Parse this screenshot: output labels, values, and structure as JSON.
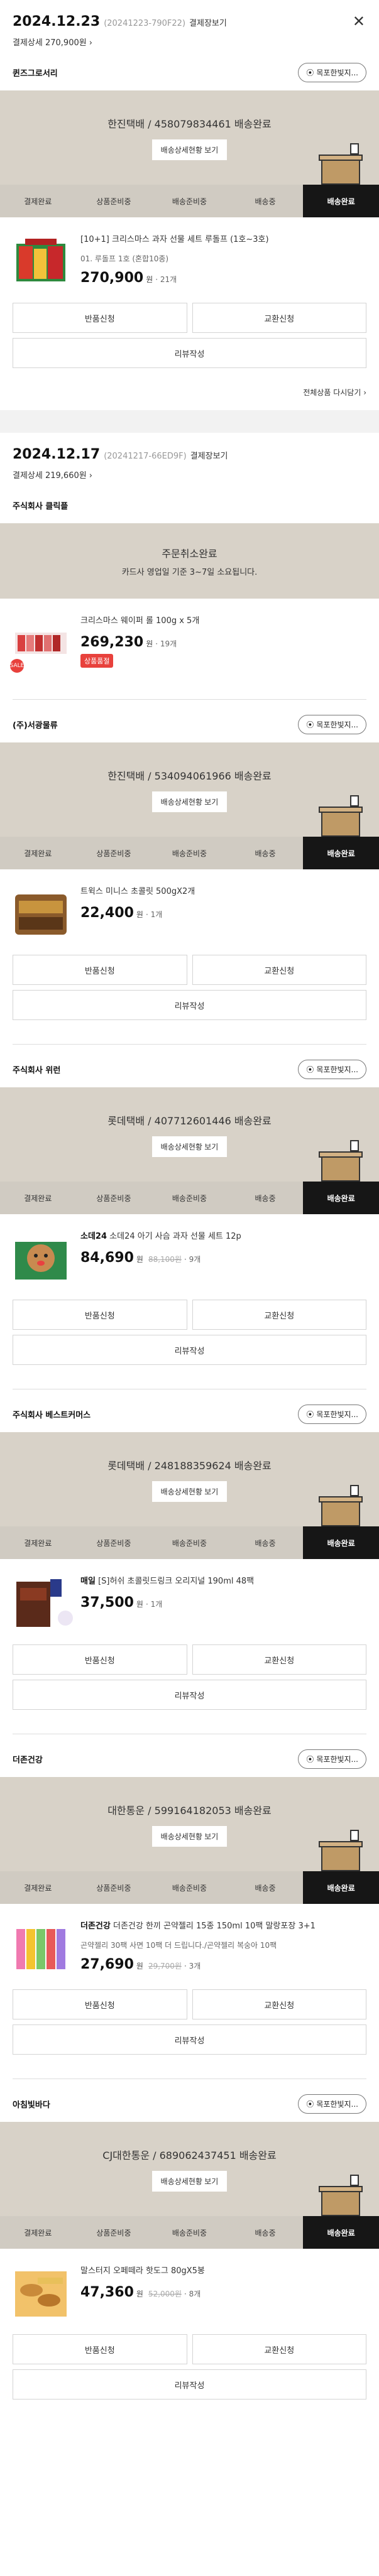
{
  "orders": [
    {
      "date": "2024.12.23",
      "order_no": "(20241223-790F22)",
      "receipt": "결제장보기",
      "detail": "결제상세 270,900원",
      "sellers": [
        {
          "name": "퀸즈그로서리",
          "pill": "목포한빛지...",
          "status_title": "한진택배 / 458079834461 배송완료",
          "status_btn": "배송상세현황 보기",
          "steps": [
            "결제완료",
            "상품준비중",
            "배송준비중",
            "배송중",
            "배송완료"
          ],
          "product": {
            "name": "[10+1] 크리스마스 과자 선물 세트 루돌프 (1호~3호)",
            "option": "01. 루돌프 1호 (혼합10종)",
            "price": "270,900",
            "won": "원",
            "qty": "· 21개"
          },
          "buttons": [
            "반품신청",
            "교환신청",
            "리뷰작성"
          ]
        }
      ],
      "history": "전체상품 다시담기"
    },
    {
      "date": "2024.12.17",
      "order_no": "(20241217-66ED9F)",
      "receipt": "결제장보기",
      "detail": "결제상세 219,660원",
      "sellers": [
        {
          "name": "주식회사 클릭플",
          "cancel_title": "주문취소완료",
          "cancel_sub": "카드사 영업일 기준 3~7일 소요됩니다.",
          "product": {
            "name": "크리스마스 웨이퍼 롤 100g x 5개",
            "price": "269,230",
            "won": "원",
            "qty": "· 19개",
            "tag": "상품품절"
          }
        },
        {
          "name": "(주)서광물류",
          "pill": "목포한빛지...",
          "status_title": "한진택배 / 534094061966 배송완료",
          "status_btn": "배송상세현황 보기",
          "steps": [
            "결제완료",
            "상품준비중",
            "배송준비중",
            "배송중",
            "배송완료"
          ],
          "product": {
            "name": "트윅스 미니스 초콜릿 500gX2개",
            "price": "22,400",
            "won": "원",
            "qty": "· 1개"
          },
          "buttons": [
            "반품신청",
            "교환신청",
            "리뷰작성"
          ]
        },
        {
          "name": "주식회사 위런",
          "pill": "목포한빛지...",
          "status_title": "롯데택배 / 407712601446 배송완료",
          "status_btn": "배송상세현황 보기",
          "steps": [
            "결제완료",
            "상품준비중",
            "배송준비중",
            "배송중",
            "배송완료"
          ],
          "product": {
            "brand": "소데24",
            "name": "소데24 아기 사슴 과자 선물 세트 12p",
            "price": "84,690",
            "won": "원",
            "orig": "88,100원",
            "qty": "· 9개"
          },
          "buttons": [
            "반품신청",
            "교환신청",
            "리뷰작성"
          ]
        },
        {
          "name": "주식회사 베스트커머스",
          "pill": "목포한빛지...",
          "status_title": "롯데택배 / 248188359624 배송완료",
          "status_btn": "배송상세현황 보기",
          "steps": [
            "결제완료",
            "상품준비중",
            "배송준비중",
            "배송중",
            "배송완료"
          ],
          "product": {
            "brand": "매일",
            "name": "[S]허쉬 초콜릿드링크 오리지널 190ml 48팩",
            "price": "37,500",
            "won": "원",
            "qty": "· 1개"
          },
          "buttons": [
            "반품신청",
            "교환신청",
            "리뷰작성"
          ]
        },
        {
          "name": "더존건강",
          "pill": "목포한빛지...",
          "status_title": "대한통운 / 599164182053 배송완료",
          "status_btn": "배송상세현황 보기",
          "steps": [
            "결제완료",
            "상품준비중",
            "배송준비중",
            "배송중",
            "배송완료"
          ],
          "product": {
            "brand": "더존건강",
            "name": "더존건강 한끼 곤약젤리 15종 150ml 10팩 말랑포장 3+1",
            "option": "곤약젤리 30팩 사면 10팩 더 드립니다./곤약젤리 복숭아 10팩",
            "price": "27,690",
            "won": "원",
            "orig": "29,700원",
            "qty": "· 3개"
          },
          "buttons": [
            "반품신청",
            "교환신청",
            "리뷰작성"
          ]
        },
        {
          "name": "아침빛바다",
          "pill": "목포한빛지...",
          "status_title": "CJ대한통운 / 689062437451 배송완료",
          "status_btn": "배송상세현황 보기",
          "steps": [
            "결제완료",
            "상품준비중",
            "배송준비중",
            "배송중",
            "배송완료"
          ],
          "product": {
            "name": "말스터지 오페떼라 핫도그 80gX5봉",
            "price": "47,360",
            "won": "원",
            "orig": "52,000원",
            "qty": "· 8개"
          },
          "buttons": [
            "반품신청",
            "교환신청",
            "리뷰작성"
          ]
        }
      ]
    }
  ],
  "colors": {
    "status_bg": "#d8d2c8",
    "stepper_bg": "#d0cbc2",
    "active_step": "#161616",
    "sold_out": "#e8413c"
  }
}
